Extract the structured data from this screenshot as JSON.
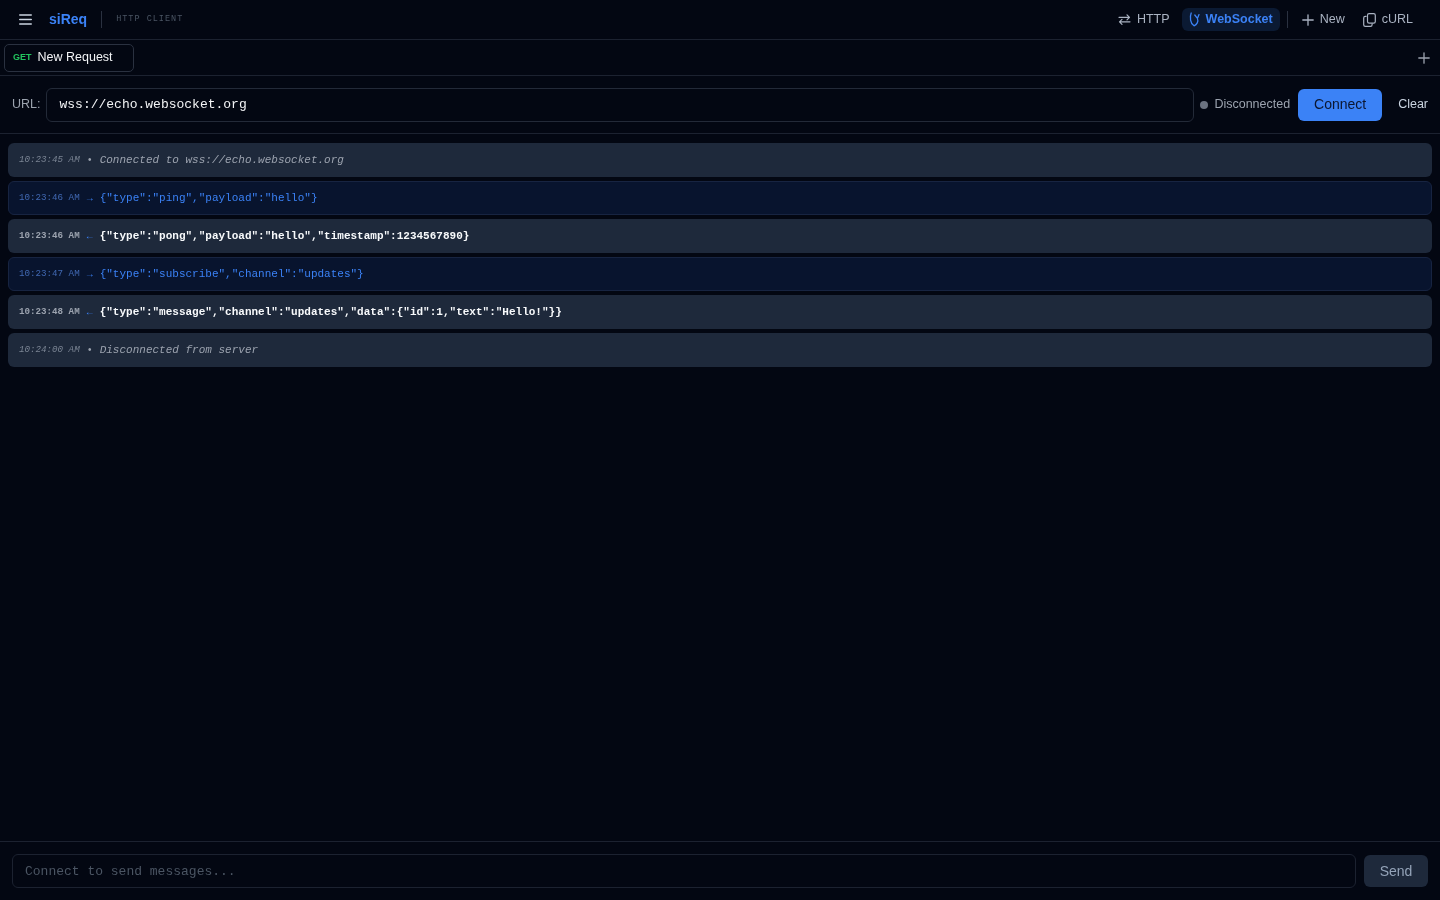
{
  "header": {
    "brand": "siReq",
    "subtitle": "HTTP CLIENT",
    "modes": [
      {
        "kind": "http",
        "label": "HTTP",
        "selected": false
      },
      {
        "kind": "websocket",
        "label": "WebSocket",
        "selected": true
      }
    ],
    "actions": [
      {
        "kind": "new",
        "label": "New"
      },
      {
        "kind": "curl",
        "label": "cURL"
      }
    ]
  },
  "tabs": [
    {
      "method": "GET",
      "label": "New Request",
      "selected": true
    }
  ],
  "connection": {
    "label": "URL:",
    "url": "wss://echo.websocket.org",
    "connected": false,
    "status": "Disconnected",
    "connect_button": "Connect",
    "clear_button": "Clear"
  },
  "messages": [
    {
      "kind": "system",
      "time": "10:23:45 AM",
      "marker": "•",
      "text": "Connected to wss://echo.websocket.org"
    },
    {
      "kind": "sent",
      "time": "10:23:46 AM",
      "marker": "→",
      "text": "{\"type\":\"ping\",\"payload\":\"hello\"}"
    },
    {
      "kind": "received",
      "time": "10:23:46 AM",
      "marker": "←",
      "text": "{\"type\":\"pong\",\"payload\":\"hello\",\"timestamp\":1234567890}"
    },
    {
      "kind": "sent",
      "time": "10:23:47 AM",
      "marker": "→",
      "text": "{\"type\":\"subscribe\",\"channel\":\"updates\"}"
    },
    {
      "kind": "received",
      "time": "10:23:48 AM",
      "marker": "←",
      "text": "{\"type\":\"message\",\"channel\":\"updates\",\"data\":{\"id\":1,\"text\":\"Hello!\"}}"
    },
    {
      "kind": "system",
      "time": "10:24:00 AM",
      "marker": "•",
      "text": "Disconnected from server"
    }
  ],
  "composer": {
    "placeholder": "Connect to send messages...",
    "disabled": true,
    "send_button": "Send"
  }
}
